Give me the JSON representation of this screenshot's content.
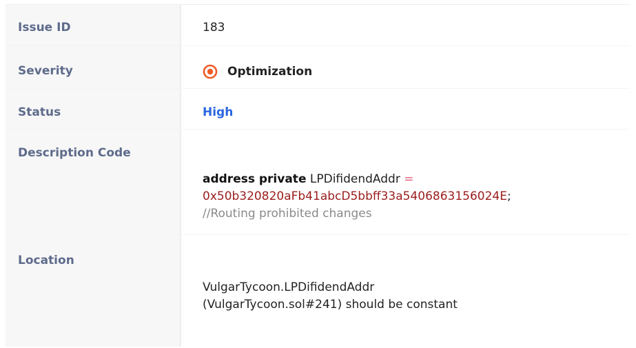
{
  "issue": {
    "rows": {
      "issue_id": {
        "label": "Issue ID",
        "value": "183"
      },
      "severity": {
        "label": "Severity",
        "value": "Optimization",
        "icon": "target-icon",
        "icon_color": "#f05a24"
      },
      "status": {
        "label": "Status",
        "value": "High",
        "color": "#2a66e0"
      },
      "description": {
        "label": "Description Code",
        "code": {
          "keywords": "address private",
          "identifier": "LPDifidendAddr",
          "operator": "=",
          "address": "0x50b320820aFb41abcD5bbff33a5406863156024E",
          "terminator": ";",
          "comment": "//Routing prohibited changes"
        }
      },
      "location": {
        "label": "Location",
        "line1": "VulgarTycoon.LPDifidendAddr",
        "line2": "(VulgarTycoon.sol#241) should be constant"
      }
    }
  }
}
